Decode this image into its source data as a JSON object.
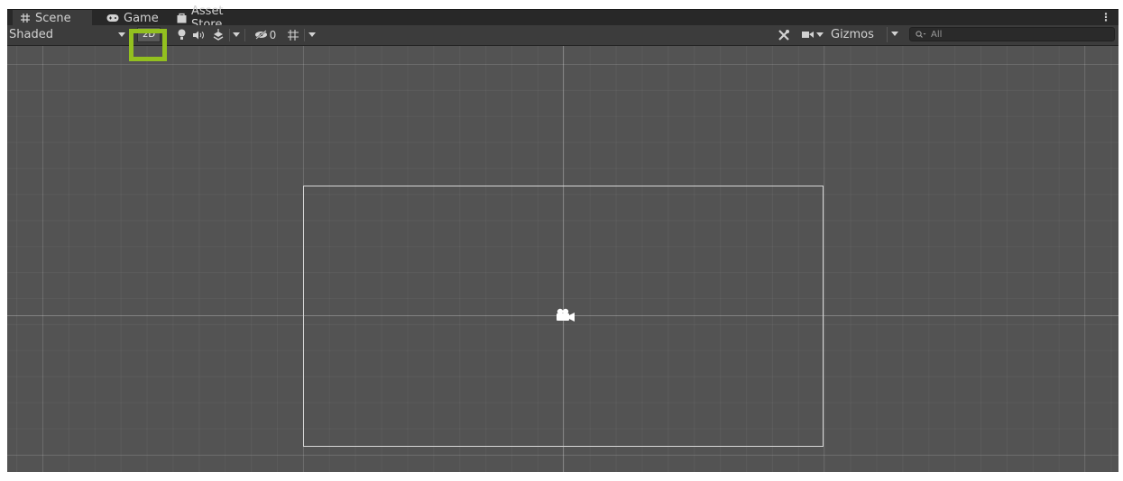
{
  "tabs": [
    {
      "label": "Scene",
      "icon": "grid-icon",
      "active": true
    },
    {
      "label": "Game",
      "icon": "gamepad-icon",
      "active": false
    },
    {
      "label": "Asset Store",
      "icon": "shopping-bag-icon",
      "active": false
    }
  ],
  "toolbar": {
    "draw_mode": "Shaded",
    "two_d_label": "2D",
    "hidden_count": "0",
    "gizmos_label": "Gizmos",
    "search_placeholder": "All"
  },
  "colors": {
    "highlight": "#93c01f",
    "viewport_bg": "#535353",
    "toolbar_bg": "#3c3c3c"
  }
}
